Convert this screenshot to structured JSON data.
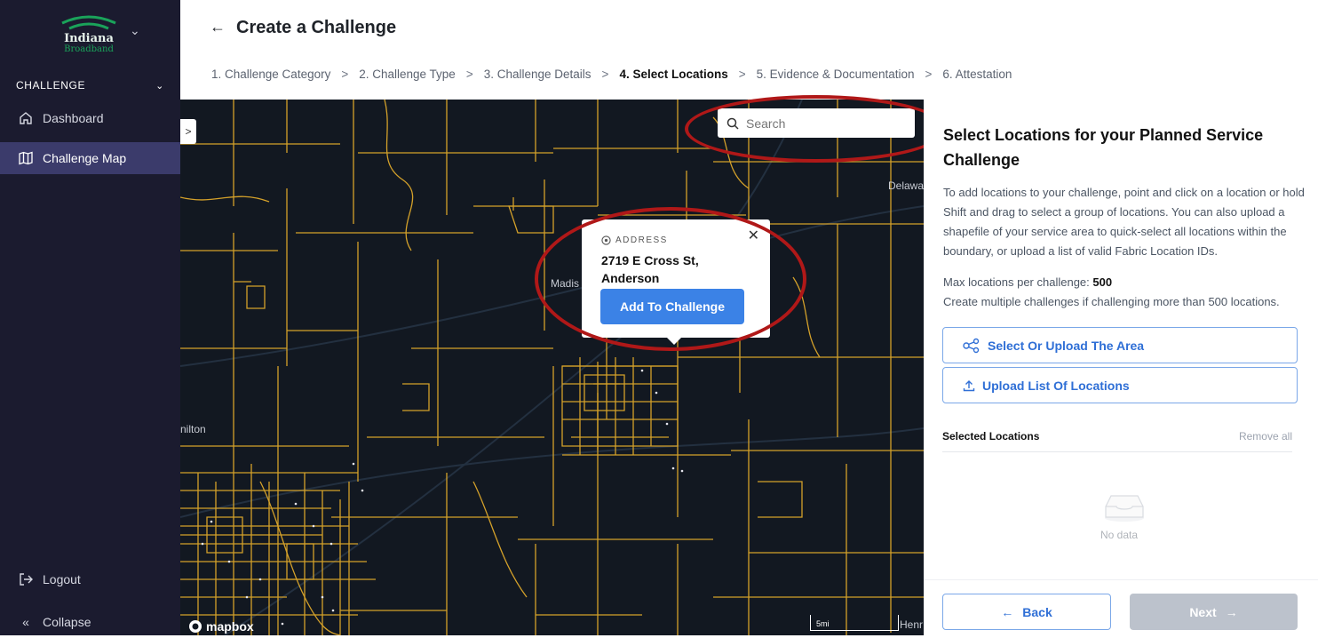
{
  "sidebar": {
    "logo_text_1": "Indiana",
    "logo_text_2": "Broadband",
    "section": "CHALLENGE",
    "items": [
      {
        "label": "Dashboard",
        "icon": "home-icon"
      },
      {
        "label": "Challenge Map",
        "icon": "map-icon",
        "active": true
      }
    ],
    "logout": "Logout",
    "collapse": "Collapse"
  },
  "header": {
    "title": "Create a Challenge",
    "steps": [
      "1. Challenge Category",
      "2. Challenge Type",
      "3. Challenge Details",
      "4. Select Locations",
      "5. Evidence & Documentation",
      "6. Attestation"
    ],
    "current_step": 3
  },
  "map": {
    "search_placeholder": "Search",
    "popup": {
      "label": "ADDRESS",
      "address": "2719 E Cross St, Anderson",
      "button": "Add To Challenge"
    },
    "labels": {
      "delaware": "Delawa",
      "madison": "Madis",
      "hamilton": "nilton",
      "henry": "Henr"
    },
    "attribution": "mapbox",
    "scale": "5mi",
    "colors": {
      "background": "#121821",
      "boundaries": "#d4a12a",
      "highlight_ring": "#b01818"
    }
  },
  "panel": {
    "title": "Select Locations for your Planned Service Challenge",
    "description": "To add locations to your challenge, point and click on a location or hold Shift and drag to select a group of locations. You can also upload a shapefile of your service area to quick-select all locations within the boundary, or upload a list of valid Fabric Location IDs.",
    "max_label": "Max locations per challenge:",
    "max_value": "500",
    "multi_note": "Create multiple challenges if challenging more than 500 locations.",
    "select_area_btn": "Select Or Upload The Area",
    "upload_list_btn": "Upload List Of Locations",
    "selected_title": "Selected Locations",
    "remove_all": "Remove all",
    "no_data": "No data",
    "back": "Back",
    "next": "Next"
  }
}
